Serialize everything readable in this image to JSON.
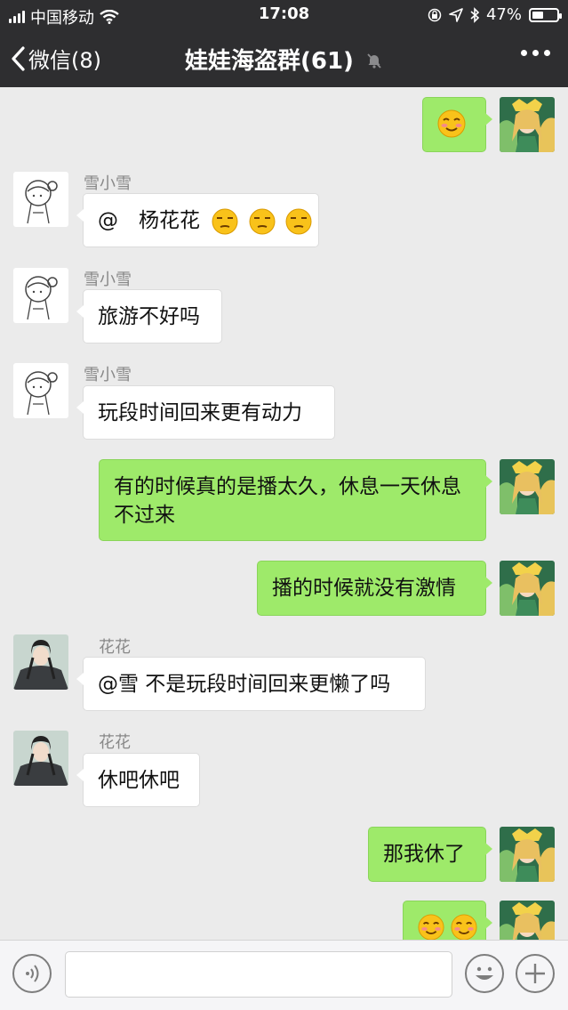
{
  "status_bar": {
    "carrier": "中国移动",
    "time": "17:08",
    "battery": "47%",
    "battery_level": 0.47
  },
  "nav": {
    "back_label": "微信(8)",
    "title": "娃娃海盗群(61)"
  },
  "messages": [
    {
      "side": "right",
      "avatar": "warrior-avatar",
      "emoji": [
        "smiling-blush-emoji"
      ]
    },
    {
      "side": "left",
      "sender": "雪小雪",
      "avatar": "sketch-girl-avatar",
      "text": "@　杨花花",
      "emoji": [
        "unamused-emoji",
        "unamused-emoji",
        "unamused-emoji"
      ]
    },
    {
      "side": "left",
      "sender": "雪小雪",
      "avatar": "sketch-girl-avatar",
      "text": "旅游不好吗"
    },
    {
      "side": "left",
      "sender": "雪小雪",
      "avatar": "sketch-girl-avatar",
      "text": "玩段时间回来更有动力"
    },
    {
      "side": "right",
      "avatar": "warrior-avatar",
      "text": "有的时候真的是播太久，休息一天休息不过来"
    },
    {
      "side": "right",
      "avatar": "warrior-avatar",
      "text": "播的时候就没有激情"
    },
    {
      "side": "left",
      "sender": "花花",
      "avatar": "swordsman-avatar",
      "text": "@雪 不是玩段时间回来更懒了吗"
    },
    {
      "side": "left",
      "sender": "花花",
      "avatar": "swordsman-avatar",
      "text": "休吧休吧"
    },
    {
      "side": "right",
      "avatar": "warrior-avatar",
      "text": "那我休了"
    },
    {
      "side": "right",
      "avatar": "warrior-avatar",
      "emoji": [
        "smiling-blush-emoji",
        "smiling-blush-emoji"
      ]
    }
  ],
  "input_bar": {
    "voice_icon": "voice-icon",
    "emoji_icon": "emoji-icon",
    "plus_icon": "plus-icon"
  },
  "colors": {
    "header": "#2e2e30",
    "chat_background": "#ebebeb",
    "outgoing_bubble": "#9eea6a",
    "incoming_bubble": "#ffffff"
  }
}
